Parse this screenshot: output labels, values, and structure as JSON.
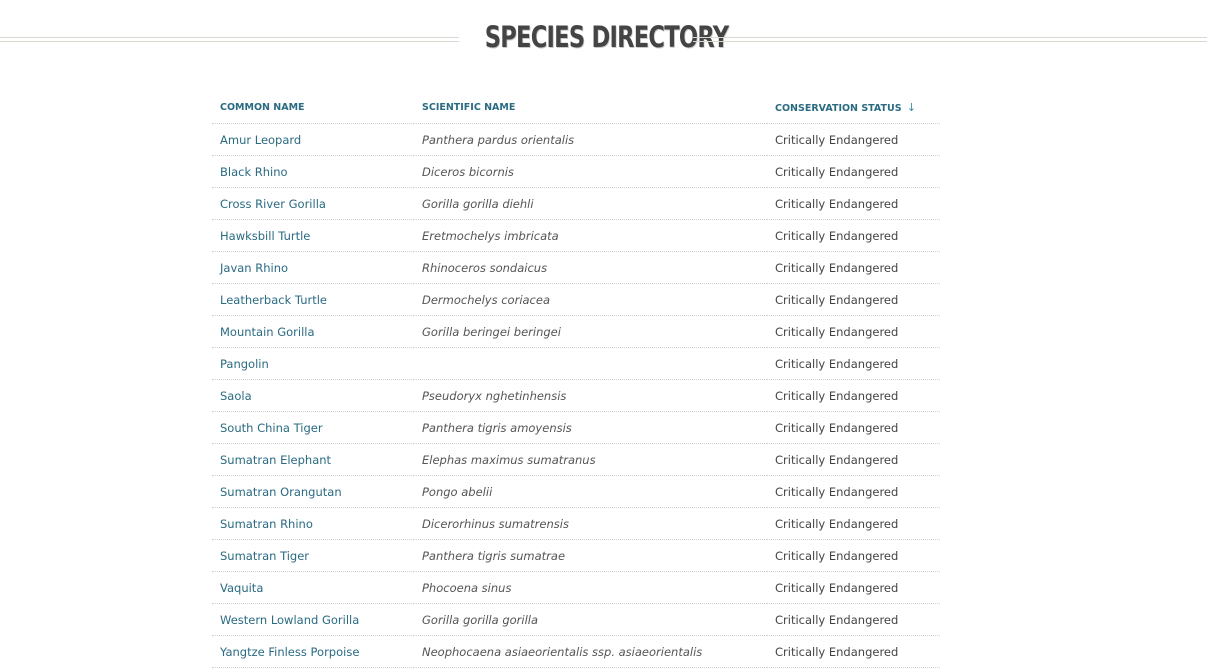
{
  "page": {
    "title": "Species Directory"
  },
  "table": {
    "columns": {
      "common_name": "COMMON NAME",
      "scientific_name": "SCIENTIFIC NAME",
      "conservation_status": "CONSERVATION STATUS",
      "sort_indicator": "↓"
    },
    "rows": [
      {
        "common": "Amur Leopard",
        "scientific": "Panthera pardus orientalis",
        "status": "Critically Endangered"
      },
      {
        "common": "Black Rhino",
        "scientific": "Diceros bicornis",
        "status": "Critically Endangered"
      },
      {
        "common": "Cross River Gorilla",
        "scientific": "Gorilla gorilla diehli",
        "status": "Critically Endangered"
      },
      {
        "common": "Hawksbill Turtle",
        "scientific": "Eretmochelys imbricata",
        "status": "Critically Endangered"
      },
      {
        "common": "Javan Rhino",
        "scientific": "Rhinoceros sondaicus",
        "status": "Critically Endangered"
      },
      {
        "common": "Leatherback Turtle",
        "scientific": "Dermochelys coriacea",
        "status": "Critically Endangered"
      },
      {
        "common": "Mountain Gorilla",
        "scientific": "Gorilla beringei beringei",
        "status": "Critically Endangered"
      },
      {
        "common": "Pangolin",
        "scientific": "",
        "status": "Critically Endangered"
      },
      {
        "common": "Saola",
        "scientific": "Pseudoryx nghetinhensis",
        "status": "Critically Endangered"
      },
      {
        "common": "South China Tiger",
        "scientific": "Panthera tigris amoyensis",
        "status": "Critically Endangered"
      },
      {
        "common": "Sumatran Elephant",
        "scientific": "Elephas maximus sumatranus",
        "status": "Critically Endangered"
      },
      {
        "common": "Sumatran Orangutan",
        "scientific": "Pongo abelii",
        "status": "Critically Endangered"
      },
      {
        "common": "Sumatran Rhino",
        "scientific": "Dicerorhinus sumatrensis",
        "status": "Critically Endangered"
      },
      {
        "common": "Sumatran Tiger",
        "scientific": "Panthera tigris sumatrae",
        "status": "Critically Endangered"
      },
      {
        "common": "Vaquita",
        "scientific": "Phocoena sinus",
        "status": "Critically Endangered"
      },
      {
        "common": "Western Lowland Gorilla",
        "scientific": "Gorilla gorilla gorilla",
        "status": "Critically Endangered"
      },
      {
        "common": "Yangtze Finless Porpoise",
        "scientific": "Neophocaena asiaeorientalis ssp. asiaeorientalis",
        "status": "Critically Endangered"
      }
    ]
  },
  "colors": {
    "link": "#2a6b82",
    "title": "#444444",
    "rule": "#ddd8cf",
    "sort_arrow": "#3e8fb0"
  }
}
